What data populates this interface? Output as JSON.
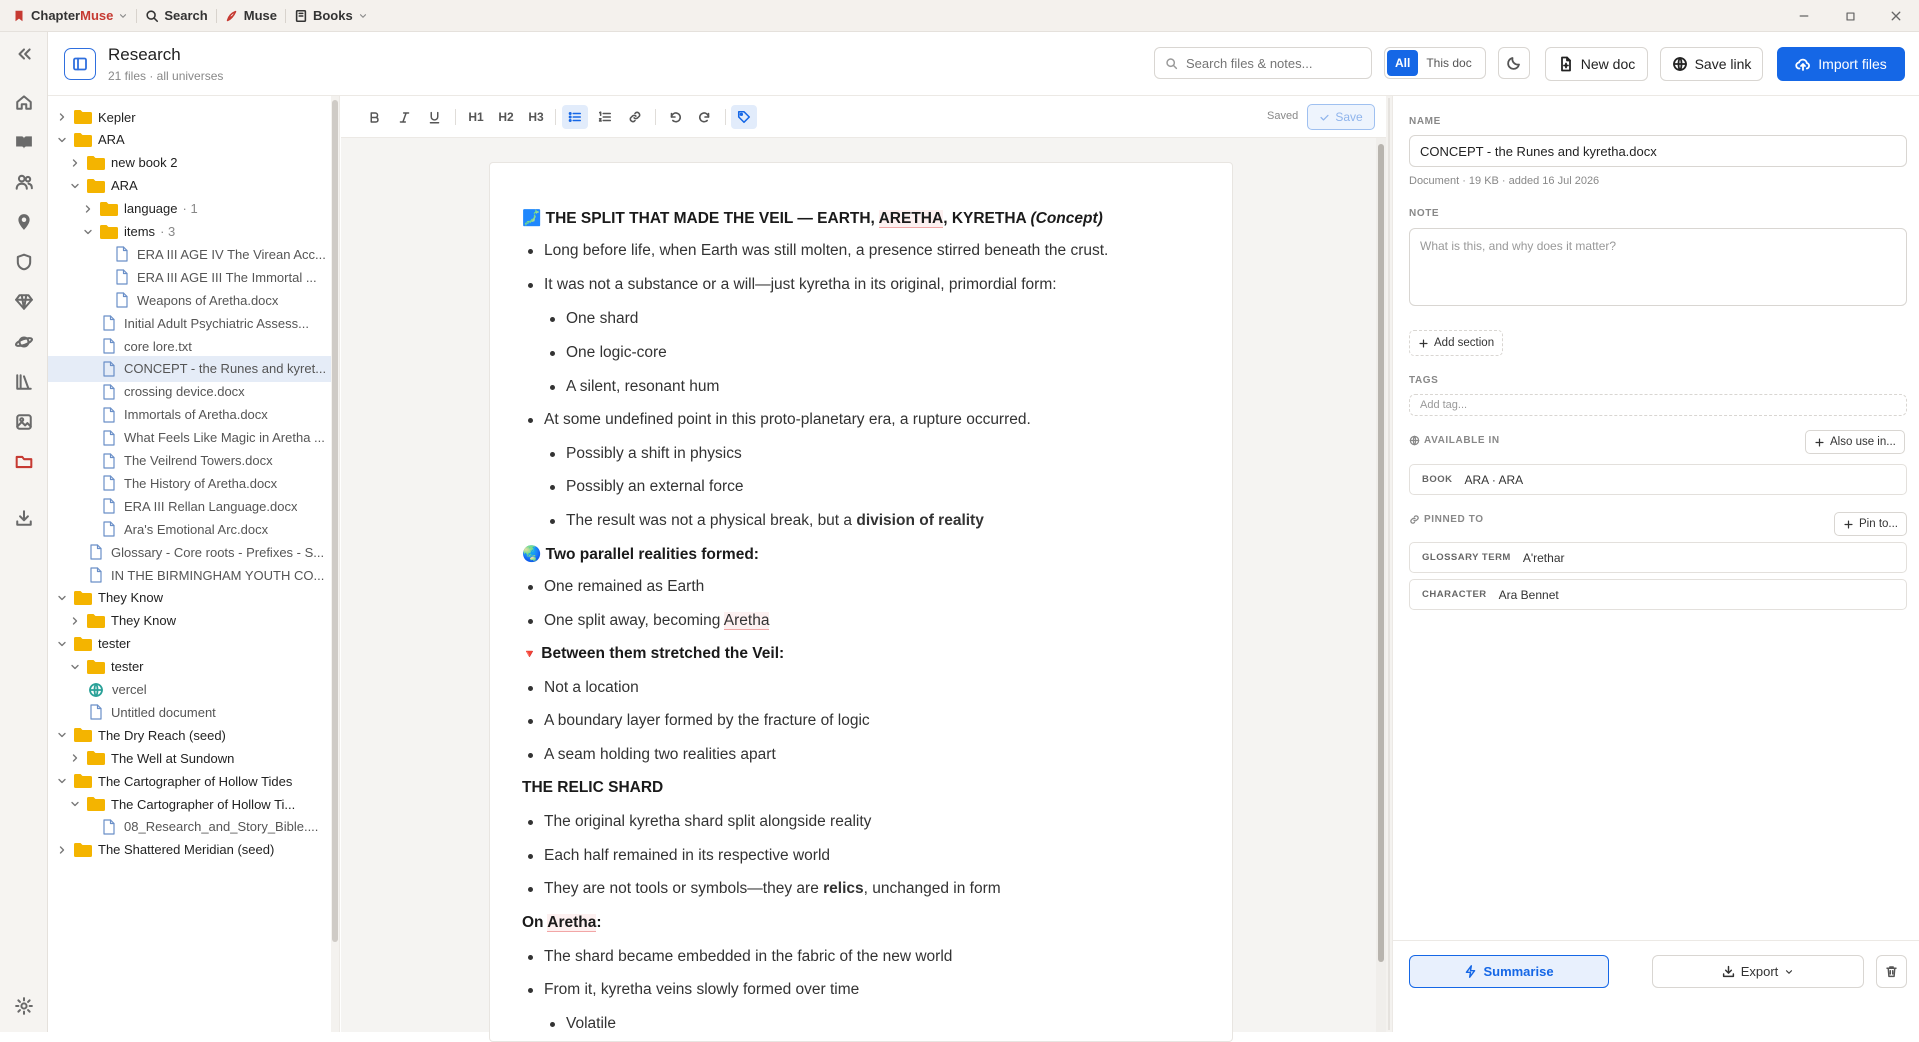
{
  "app": {
    "brand": "ChapterMuse",
    "menu": [
      {
        "label": "Search",
        "icon": "search-icon"
      },
      {
        "label": "Muse",
        "icon": "quill-icon"
      },
      {
        "label": "Books",
        "icon": "book-icon"
      }
    ]
  },
  "header": {
    "title": "Research",
    "subtitle": "21 files · all universes",
    "search_placeholder": "Search files & notes...",
    "scope_all": "All",
    "scope_doc": "This doc",
    "new_doc": "New doc",
    "save_link": "Save link",
    "import_files": "Import files"
  },
  "tree": {
    "rows": [
      {
        "label": "Kepler",
        "type": "folder",
        "expanded": false
      },
      {
        "label": "ARA",
        "type": "folder",
        "expanded": true
      },
      {
        "label": "new book 2",
        "type": "folder",
        "expanded": false
      },
      {
        "label": "ARA",
        "type": "folder",
        "expanded": true
      },
      {
        "label": "language",
        "type": "folder",
        "expanded": false,
        "count": "· 1"
      },
      {
        "label": "items",
        "type": "folder",
        "expanded": true,
        "count": "· 3"
      },
      {
        "label": "ERA III AGE IV The Virean Acc...",
        "type": "file"
      },
      {
        "label": "ERA III AGE III The Immortal ...",
        "type": "file"
      },
      {
        "label": "Weapons of Aretha.docx",
        "type": "file"
      },
      {
        "label": "Initial Adult Psychiatric Assess...",
        "type": "file"
      },
      {
        "label": "core lore.txt",
        "type": "file"
      },
      {
        "label": "CONCEPT - the Runes and kyret...",
        "type": "file",
        "selected": true
      },
      {
        "label": "crossing device.docx",
        "type": "file"
      },
      {
        "label": "Immortals of Aretha.docx",
        "type": "file"
      },
      {
        "label": "What Feels Like Magic in Aretha ...",
        "type": "file"
      },
      {
        "label": "The Veilrend Towers.docx",
        "type": "file"
      },
      {
        "label": "The History of Aretha.docx",
        "type": "file"
      },
      {
        "label": "ERA III Rellan Language.docx",
        "type": "file"
      },
      {
        "label": "Ara's Emotional Arc.docx",
        "type": "file"
      },
      {
        "label": "Glossary - Core roots - Prefixes - S...",
        "type": "file"
      },
      {
        "label": "IN THE BIRMINGHAM YOUTH CO...",
        "type": "file"
      },
      {
        "label": "They Know",
        "type": "folder",
        "expanded": true
      },
      {
        "label": "They Know",
        "type": "folder",
        "expanded": false
      },
      {
        "label": "tester",
        "type": "folder",
        "expanded": true
      },
      {
        "label": "tester",
        "type": "folder",
        "expanded": true
      },
      {
        "label": "vercel",
        "type": "link"
      },
      {
        "label": "Untitled document",
        "type": "file"
      },
      {
        "label": "The Dry Reach (seed)",
        "type": "folder",
        "expanded": true
      },
      {
        "label": "The Well at Sundown",
        "type": "folder",
        "expanded": false
      },
      {
        "label": "The Cartographer of Hollow Tides",
        "type": "folder",
        "expanded": true
      },
      {
        "label": "The Cartographer of Hollow Ti...",
        "type": "folder",
        "expanded": true
      },
      {
        "label": "08_Research_and_Story_Bible....",
        "type": "file"
      },
      {
        "label": "The Shattered Meridian (seed)",
        "type": "folder",
        "expanded": false
      }
    ]
  },
  "editor": {
    "saved_label": "Saved",
    "save_label": "Save",
    "toolbar": {
      "h1": "H1",
      "h2": "H2",
      "h3": "H3"
    },
    "doc": {
      "h1_emoji": "🗾",
      "h1_pre": "THE SPLIT THAT MADE THE VEIL — EARTH, ",
      "h1_kw": "ARETHA",
      "h1_post": ", KYRETHA ",
      "h1_italic": "(Concept)",
      "l1": "Long before life, when Earth was still molten, a presence stirred beneath the crust.",
      "l2": "It was not a substance or a will—just kyretha in its original, primordial form:",
      "l3": "One shard",
      "l4": "One logic-core",
      "l5": "A silent, resonant hum",
      "l6": "At some undefined point in this proto-planetary era, a rupture occurred.",
      "l7": "Possibly a shift in physics",
      "l8": "Possibly an external force",
      "l9_pre": "The result was not a physical break, but a ",
      "l9_bold": "division of reality",
      "h2_emoji": "🌏",
      "h2": "Two parallel realities formed:",
      "l10": "One remained as Earth",
      "l11_pre": "One split away, becoming ",
      "l11_kw": "Aretha",
      "h3_emoji": "🔻",
      "h3": "Between them stretched the Veil:",
      "l12": "Not a location",
      "l13": "A boundary layer formed by the fracture of logic",
      "l14": "A seam holding two realities apart",
      "h4": "THE RELIC SHARD",
      "l15": "The original kyretha shard split alongside reality",
      "l16": "Each half remained in its respective world",
      "l17_pre": "They are not tools or symbols—they are ",
      "l17_bold": "relics",
      "l17_post": ", unchanged in form",
      "h5_pre": "On ",
      "h5_kw": "Aretha",
      "h5_post": ":",
      "l18": "The shard became embedded in the fabric of the new world",
      "l19": "From it, kyretha veins slowly formed over time",
      "l20": "Volatile"
    }
  },
  "inspector": {
    "name_label": "NAME",
    "name_value": "CONCEPT - the Runes and kyretha.docx",
    "meta": "Document · 19 KB · added 16 Jul 2026",
    "note_label": "NOTE",
    "note_placeholder": "What is this, and why does it matter?",
    "add_section": "Add section",
    "tags_label": "TAGS",
    "tags_placeholder": "Add tag...",
    "available_label": "AVAILABLE IN",
    "also_use": "Also use in...",
    "book_key": "BOOK",
    "book_val": "ARA · ARA",
    "pinned_label": "PINNED TO",
    "pin_to": "Pin to...",
    "pins": [
      {
        "key": "GLOSSARY TERM",
        "val": "A'rethar"
      },
      {
        "key": "CHARACTER",
        "val": "Ara Bennet"
      }
    ],
    "summarise": "Summarise",
    "export": "Export"
  }
}
